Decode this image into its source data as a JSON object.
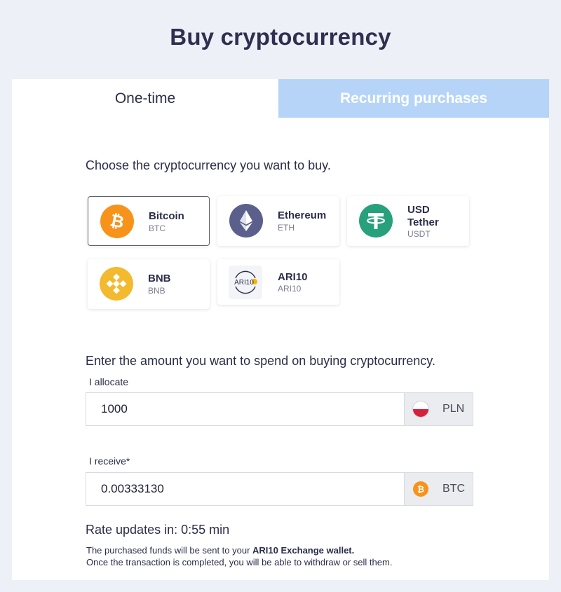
{
  "page": {
    "title": "Buy cryptocurrency"
  },
  "tabs": [
    {
      "label": "One-time",
      "active": true
    },
    {
      "label": "Recurring purchases",
      "active": false
    }
  ],
  "choose_label": "Choose the cryptocurrency you want to buy.",
  "coins": [
    {
      "name": "Bitcoin",
      "symbol": "BTC",
      "icon": "bitcoin-icon",
      "color": "#f7931a",
      "selected": true
    },
    {
      "name": "Ethereum",
      "symbol": "ETH",
      "icon": "ethereum-icon",
      "color": "#5a5f8c",
      "selected": false
    },
    {
      "name": "USD Tether",
      "symbol": "USDT",
      "icon": "tether-icon",
      "color": "#26a17b",
      "selected": false
    },
    {
      "name": "BNB",
      "symbol": "BNB",
      "icon": "bnb-icon",
      "color": "#f3ba2f",
      "selected": false
    },
    {
      "name": "ARI10",
      "symbol": "ARI10",
      "icon": "ari10-logo",
      "logo_text": "ARI10",
      "selected": false
    }
  ],
  "amount_label": "Enter the amount you want to spend on buying cryptocurrency.",
  "allocate": {
    "label": "I allocate",
    "value": "1000",
    "currency": "PLN",
    "currency_icon": "poland-flag-icon"
  },
  "receive": {
    "label": "I receive*",
    "value": "0.00333130",
    "currency": "BTC",
    "currency_icon": "bitcoin-icon"
  },
  "rate_text": "Rate updates in: 0:55 min",
  "note": {
    "prefix": "The purchased funds will be sent to your ",
    "wallet": "ARI10 Exchange wallet.",
    "line2": "Once the transaction is completed, you will be able to withdraw or sell them."
  },
  "colors": {
    "accent_tab": "#b5d4f7",
    "background": "#eef0f7",
    "text": "#2b2d4a"
  }
}
